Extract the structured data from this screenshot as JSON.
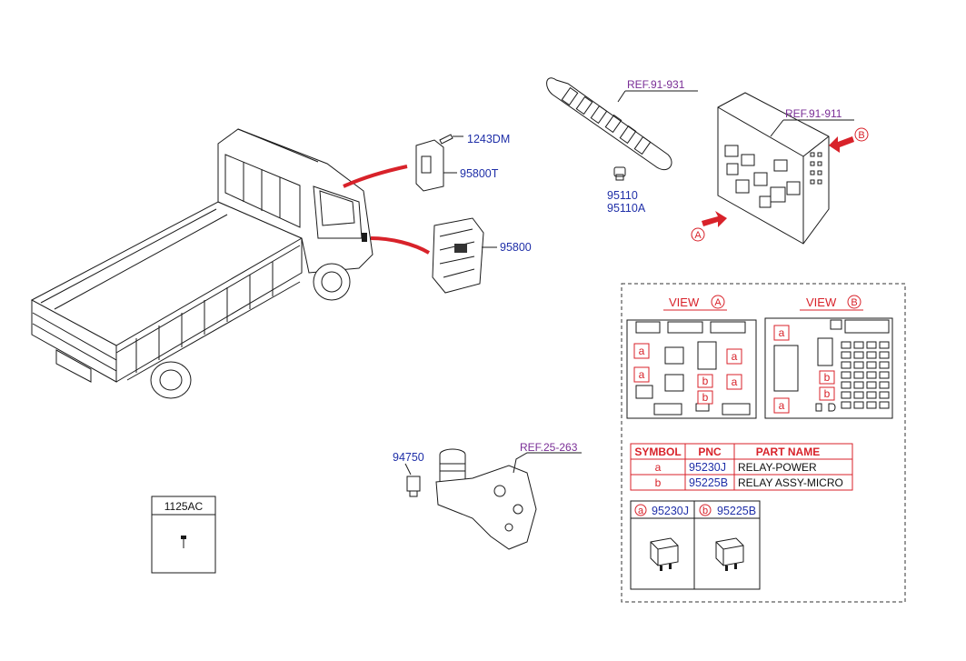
{
  "parts": {
    "p1243dm": "1243DM",
    "p95800t": "95800T",
    "p95800": "95800",
    "p95110": "95110",
    "p95110a": "95110A",
    "p94750": "94750",
    "ref_91_931": "REF.91-931",
    "ref_91_911": "REF.91-911",
    "ref_25_263": "REF.25-263"
  },
  "bolt_box": {
    "code": "1125AC"
  },
  "markers": {
    "a": "a",
    "b": "b",
    "A": "A",
    "B": "B"
  },
  "views": {
    "view_label": "VIEW",
    "view_a_letter": "A",
    "view_b_letter": "B"
  },
  "relay_table": {
    "headers": [
      "SYMBOL",
      "PNC",
      "PART NAME"
    ],
    "rows": [
      {
        "symbol": "a",
        "pnc": "95230J",
        "name": "RELAY-POWER"
      },
      {
        "symbol": "b",
        "pnc": "95225B",
        "name": "RELAY ASSY-MICRO"
      }
    ]
  },
  "relay_boxes": [
    {
      "symbol": "a",
      "pnc": "95230J"
    },
    {
      "symbol": "b",
      "pnc": "95225B"
    }
  ],
  "colors": {
    "red": "#d8222a",
    "blue": "#1f2fa8",
    "purple": "#7a2e96"
  }
}
